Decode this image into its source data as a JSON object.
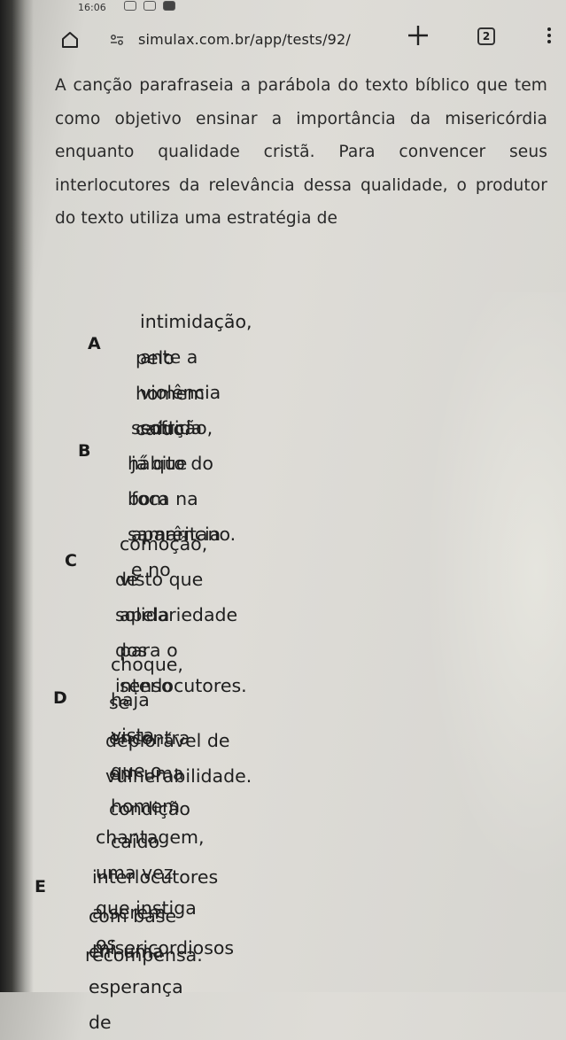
{
  "status_bar": {
    "time": "16:06"
  },
  "browser": {
    "url": "simulax.com.br/app/tests/92/",
    "url_icon": "site-settings-icon",
    "tab_count": "2"
  },
  "question": {
    "text": "A canção parafraseia a parábola do texto bíblico que tem como objetivo ensinar a importância da misericórdia enquanto qualidade cristã. Para convencer seus interlocutores da relevância dessa qualidade, o produtor do texto utiliza uma estratégia de"
  },
  "options": [
    {
      "letter": "A",
      "lines": [
        "intimidação, ante a violência sofrida",
        "pelo homem caído."
      ]
    },
    {
      "letter": "B",
      "lines": [
        "sedução, já que foca na aparência e no",
        "hábito do bom samaritano."
      ]
    },
    {
      "letter": "C",
      "lines": [
        "comoção, visto que apela para o senso",
        "de solidariedade dos interlocutores."
      ]
    },
    {
      "letter": "D",
      "lines": [
        "choque, haja vista que o homem caído",
        "se encontra em uma condição",
        "deplorável de vulnerabilidade."
      ]
    },
    {
      "letter": "E",
      "lines": [
        "chantagem, uma vez que instiga os",
        "interlocutores a serem misericordiosos",
        "com base em uma esperança de",
        "recompensa."
      ]
    }
  ]
}
